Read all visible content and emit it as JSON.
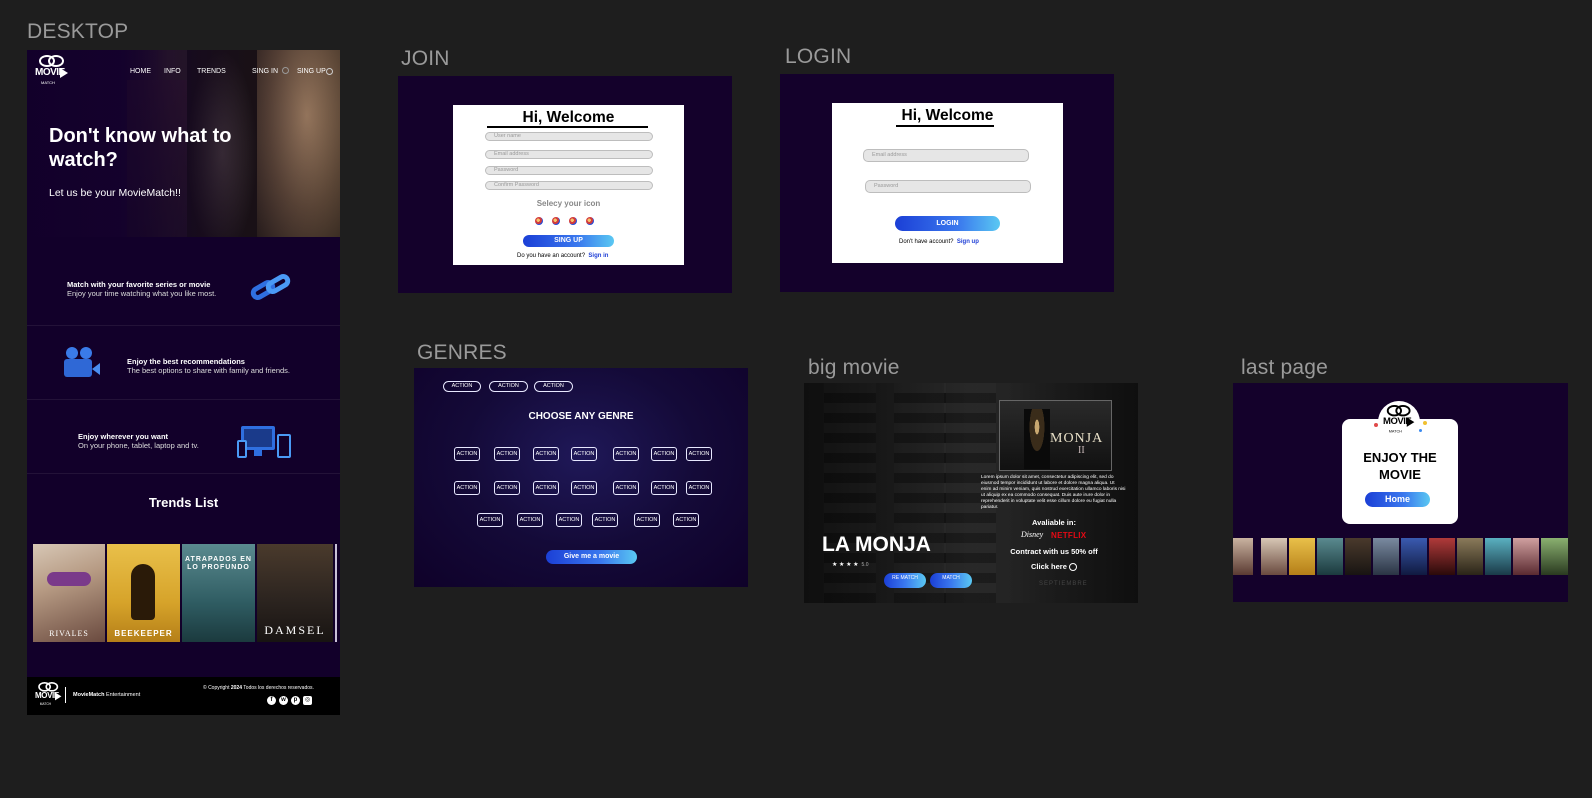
{
  "labels": {
    "desktop": "DESKTOP",
    "join": "JOIN",
    "login": "LOGIN",
    "genres": "GENRES",
    "big_movie": "big movie",
    "last_page": "last page"
  },
  "desktop": {
    "logo": {
      "word": "MOVIE",
      "sub": "MATCH"
    },
    "nav": {
      "home": "HOME",
      "info": "INFO",
      "trends": "TRENDS",
      "sign_in": "SING IN",
      "sign_up": "SING UP"
    },
    "hero": {
      "title": "Don't know what to watch?",
      "subtitle": "Let us be your MovieMatch!!"
    },
    "features": [
      {
        "title": "Match with your favorite series or movie",
        "text": "Enjoy your time watching what you like most."
      },
      {
        "title": "Enjoy the best recommendations",
        "text": "The best options to share with family and friends."
      },
      {
        "title": "Enjoy wherever you want",
        "text": "On your phone, tablet, laptop and tv."
      }
    ],
    "trends_title": "Trends List",
    "posters": [
      "RIVALES",
      "BEEKEEPER",
      "ATRAPADOS EN LO PROFUNDO",
      "DAMSEL"
    ],
    "footer": {
      "brand": "MovieMatch",
      "brand_rest": " Entertainment",
      "copyright": "© Copyright ",
      "year": "2024",
      "rights": " Todos los derechos reservados."
    }
  },
  "join": {
    "title": "Hi, Welcome",
    "username_placeholder": "User name",
    "email_placeholder": "Email address",
    "password_placeholder": "Password",
    "confirm_placeholder": "Confirm Password",
    "select_icon": "Selecy your icon",
    "signup_button": "SING UP",
    "have_account": "Do you have an account?",
    "sign_in_link": "Sign in"
  },
  "login": {
    "title": "Hi, Welcome",
    "email_placeholder": "Email address",
    "password_placeholder": "Password",
    "login_button": "LOGIN",
    "no_account": "Don't have account?",
    "sign_up_link": "Sign up"
  },
  "genres": {
    "top_pill": "ACTION",
    "title": "CHOOSE ANY GENRE",
    "pill": "ACTION",
    "button": "Give me a movie"
  },
  "big_movie": {
    "poster_title": "MONJA",
    "poster_numeral": "II",
    "lorem": "Lorem ipsum dolor sit amet, consectetur adipiscing elit, sed do eiusmod tempor incididunt ut labore et dolore magna aliqua. Ut enim ad minim veniam, quis nostrud exercitation ullamco laboris nisi ut aliquip ex ea commodo consequat. Duis aute irure dolor in reprehenderit in voluptate velit esse cillum dolore eu fugiat nulla pariatur.",
    "title": "LA MONJA",
    "stars": "★ ★ ★ ★",
    "rating": "5.0",
    "rematch_button": "RE MATCH",
    "match_button": "MATCH",
    "available_in": "Avaliable in:",
    "disney": "Disney",
    "netflix": "NETFLIX",
    "contract": "Contract with us 50% off",
    "click_here": "Click here",
    "septiembre": "SEPTIEMBRE"
  },
  "last_page": {
    "title_line1": "ENJOY THE",
    "title_line2": "MOVIE",
    "home_button": "Home"
  },
  "colors": {
    "canvas": "#1e1e1e",
    "frame_bg": "#14012b",
    "accent_start": "#1b3fd6",
    "accent_end": "#5ac8f2",
    "netflix": "#e50914",
    "link": "#1e3ed6"
  }
}
